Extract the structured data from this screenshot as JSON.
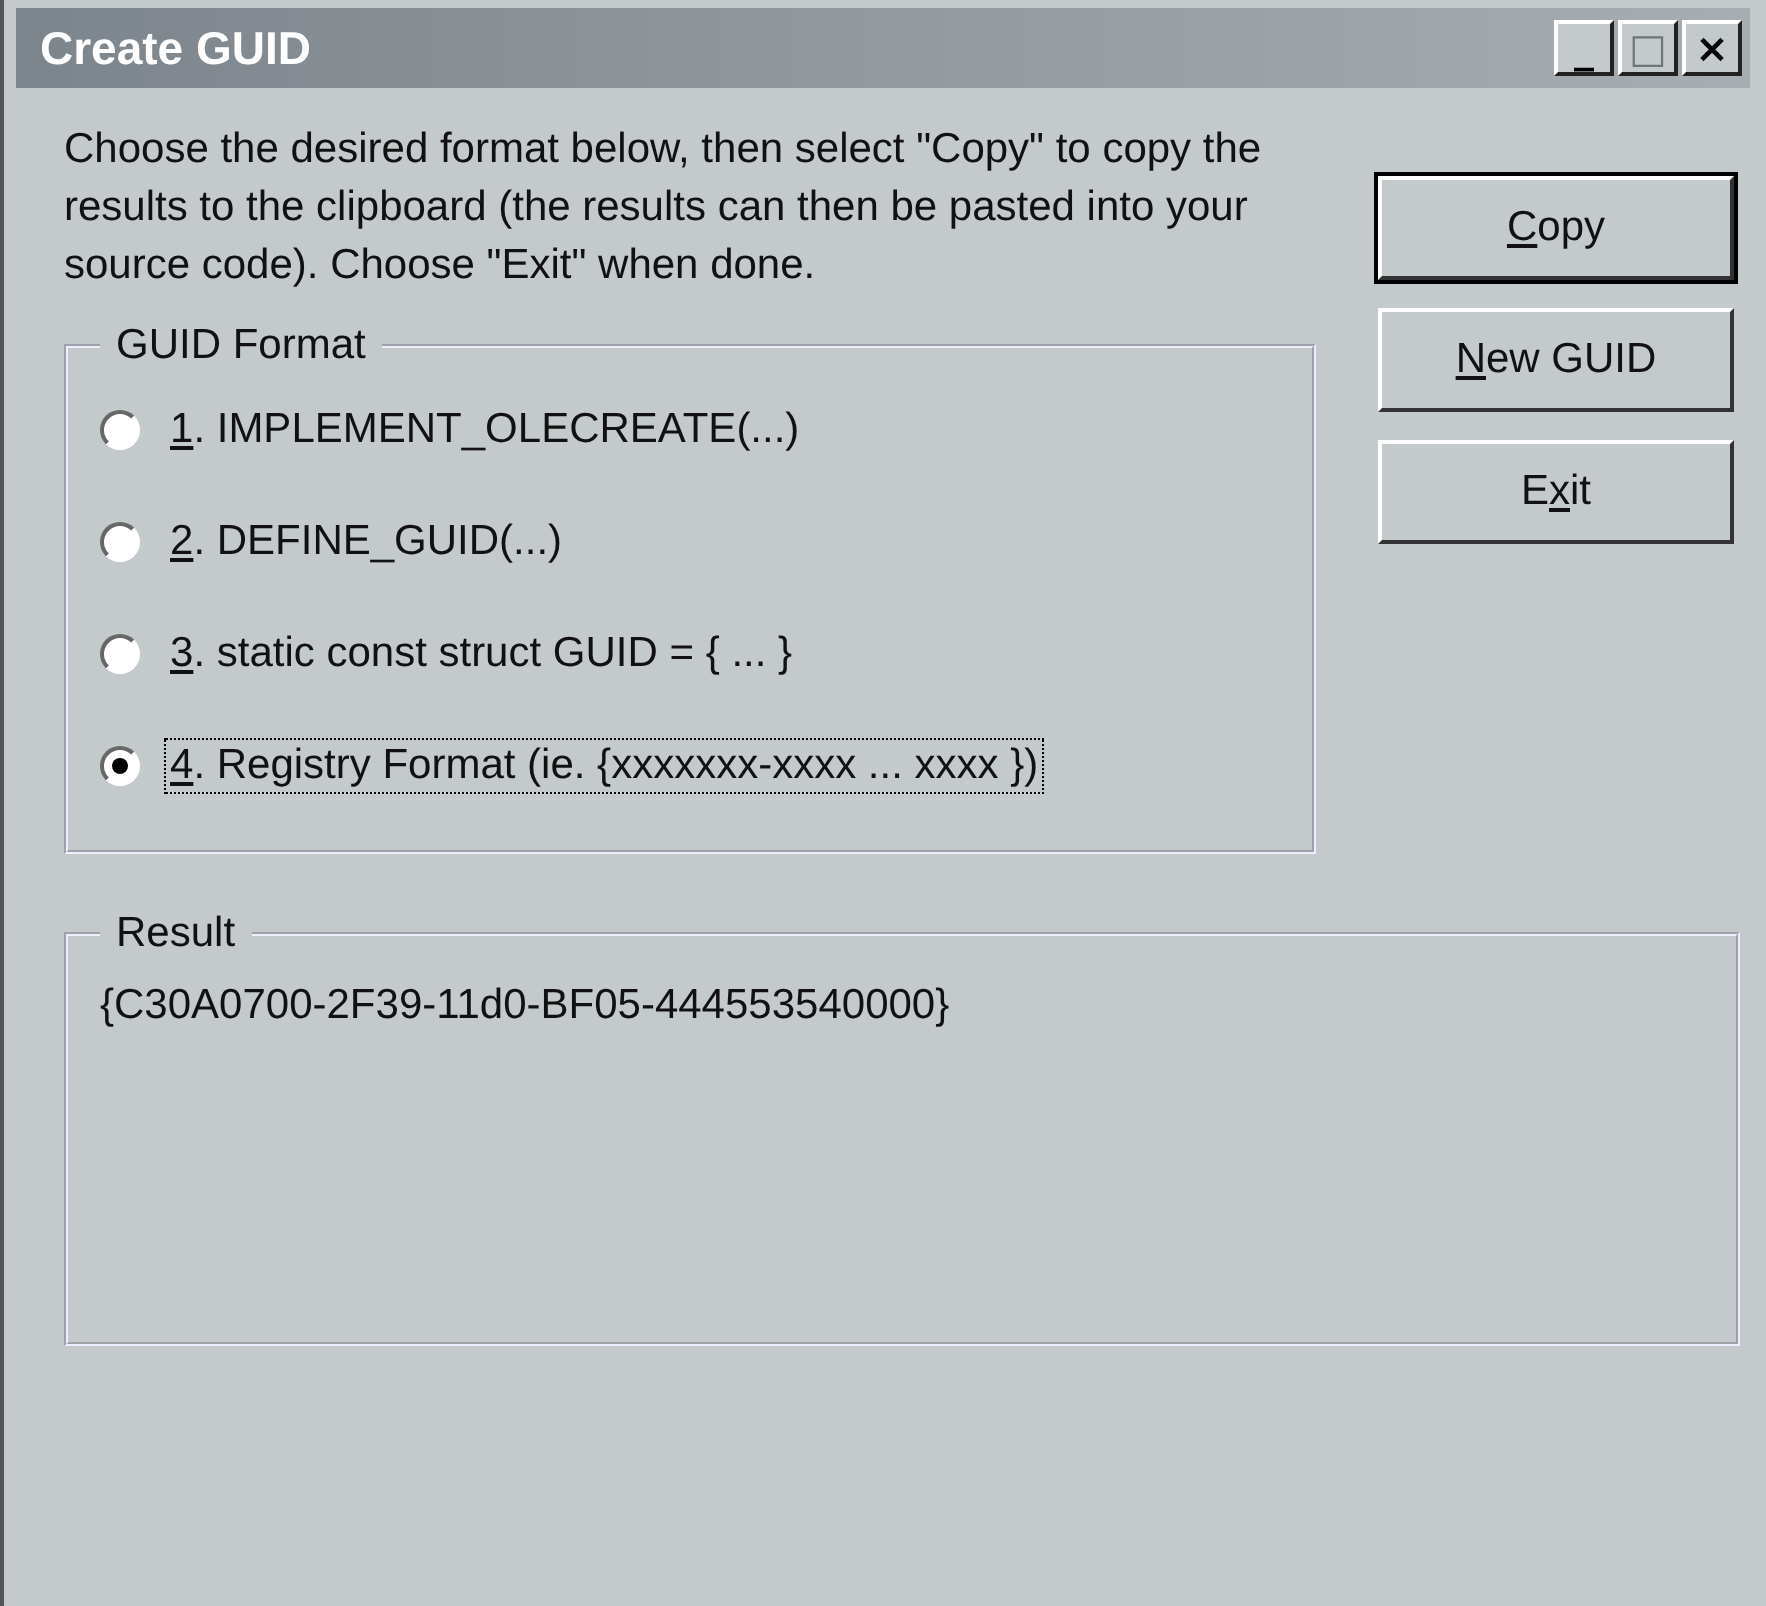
{
  "window": {
    "title": "Create GUID",
    "controls": [
      {
        "glyph": "_",
        "disabled": false
      },
      {
        "glyph": "□",
        "disabled": true
      },
      {
        "glyph": "×",
        "disabled": false
      }
    ]
  },
  "instructions": "Choose the desired format below, then select \"Copy\" to copy the results to the clipboard (the results can then be pasted into your source code).  Choose \"Exit\" when done.",
  "buttons": [
    {
      "mnemonic": "C",
      "rest": "opy",
      "default": true
    },
    {
      "mnemonic": "N",
      "rest": "ew GUID",
      "default": false
    },
    {
      "before": "E",
      "mnemonic": "x",
      "rest": "it",
      "default": false
    }
  ],
  "guid_format": {
    "title": "GUID Format",
    "options": [
      {
        "mnemonic": "1",
        "rest": ". IMPLEMENT_OLECREATE(...)",
        "selected": false,
        "focused": false
      },
      {
        "mnemonic": "2",
        "rest": ". DEFINE_GUID(...)",
        "selected": false,
        "focused": false
      },
      {
        "mnemonic": "3",
        "rest": ". static const struct GUID = { ... }",
        "selected": false,
        "focused": false
      },
      {
        "mnemonic": "4",
        "rest": ". Registry Format (ie. {xxxxxxx-xxxx ... xxxx })",
        "selected": true,
        "focused": true
      }
    ]
  },
  "result": {
    "title": "Result",
    "value": "{C30A0700-2F39-11d0-BF05-444553540000}"
  }
}
